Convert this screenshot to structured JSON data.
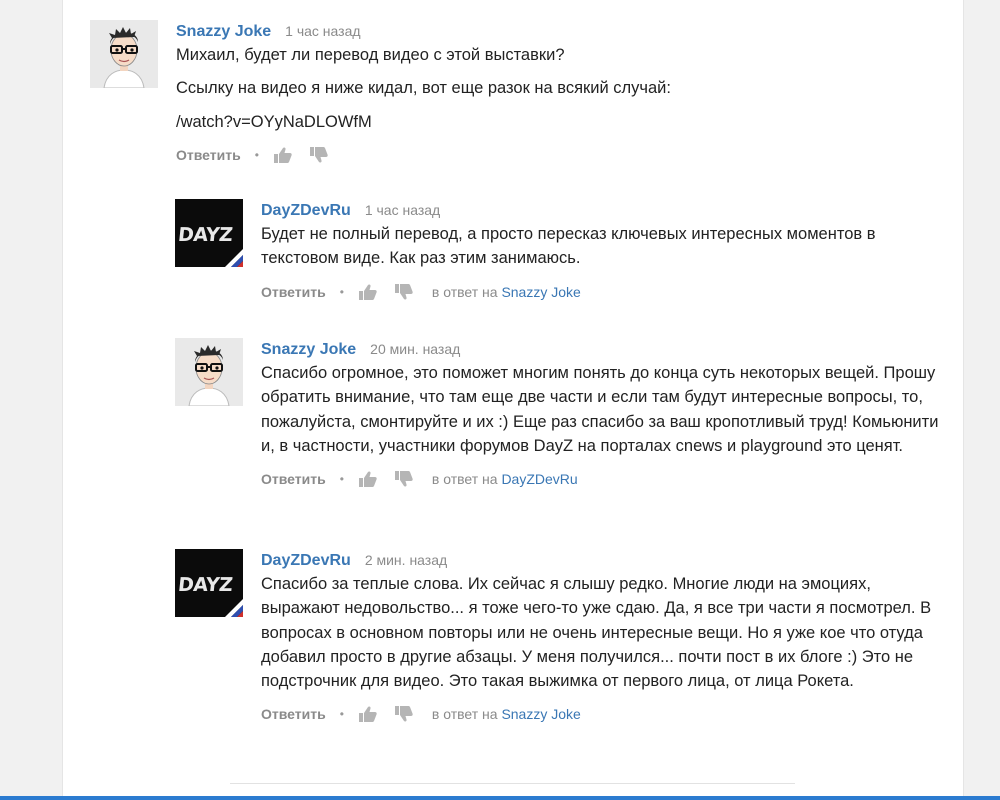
{
  "comments": [
    {
      "author": "Snazzy Joke",
      "time": "1 час назад",
      "avatar": "snazzy-avatar",
      "paragraphs": [
        "Михаил, будет ли перевод видео с этой выставки?",
        "Ссылку на видео я ниже кидал, вот еще разок на всякий случай:",
        "/watch?v=OYyNaDLOWfM"
      ],
      "reply_label": "Ответить",
      "in_reply_prefix": "",
      "in_reply_to": ""
    },
    {
      "author": "DayZDevRu",
      "time": "1 час назад",
      "avatar": "dayz-logo",
      "paragraphs": [
        "Будет не полный перевод, а просто пересказ ключевых интересных моментов в текстовом виде. Как раз этим занимаюсь."
      ],
      "reply_label": "Ответить",
      "in_reply_prefix": "в ответ на",
      "in_reply_to": "Snazzy Joke"
    },
    {
      "author": "Snazzy Joke",
      "time": "20 мин. назад",
      "avatar": "snazzy-avatar",
      "paragraphs": [
        "Спасибо огромное, это поможет многим понять до конца суть некоторых вещей. Прошу обратить внимание, что там еще две части и если там будут интересные вопросы, то, пожалуйста, смонтируйте и их :) Еще раз спасибо за ваш кропотливый труд! Комьюнити и, в частности, участники форумов DayZ на порталах cnews и playground это ценят."
      ],
      "reply_label": "Ответить",
      "in_reply_prefix": "в ответ на",
      "in_reply_to": "DayZDevRu"
    },
    {
      "author": "DayZDevRu",
      "time": "2 мин. назад",
      "avatar": "dayz-logo",
      "paragraphs": [
        "Спасибо за теплые слова. Их сейчас я слышу редко. Многие люди на эмоциях, выражают недовольство... я тоже чего-то уже сдаю. Да, я все три части я посмотрел. В вопросах в основном повторы или не очень интересные вещи. Но я уже кое что отуда добавил просто в другие абзацы. У меня получился... почти пост в их блоге :) Это не подстрочник для видео. Это такая выжимка от первого лица, от лица Рокета."
      ],
      "reply_label": "Ответить",
      "in_reply_prefix": "в ответ на",
      "in_reply_to": "Snazzy Joke"
    }
  ],
  "dayz_logo_text": "DAYZ",
  "colors": {
    "author": "#3a77b4",
    "meta": "#8a8a8a",
    "text": "#222222",
    "bottom_bar": "#2b7bd0"
  }
}
